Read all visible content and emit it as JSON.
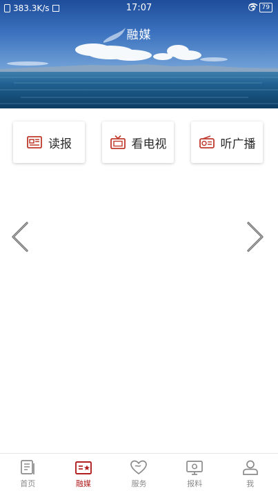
{
  "status_bar": {
    "network_speed": "383.3K/s",
    "time": "17:07",
    "battery": "79"
  },
  "page_title": "融媒",
  "features": [
    {
      "label": "读报",
      "icon": "newspaper-icon"
    },
    {
      "label": "看电视",
      "icon": "tv-icon"
    },
    {
      "label": "听广播",
      "icon": "radio-icon"
    }
  ],
  "carousel": {
    "prev_icon": "chevron-left-icon",
    "next_icon": "chevron-right-icon"
  },
  "tabbar": {
    "active": "融媒",
    "items": [
      {
        "label": "首页",
        "icon": "home-doc-icon"
      },
      {
        "label": "融媒",
        "icon": "media-icon"
      },
      {
        "label": "服务",
        "icon": "service-heart-icon"
      },
      {
        "label": "报料",
        "icon": "report-icon"
      },
      {
        "label": "我",
        "icon": "user-icon"
      }
    ]
  },
  "colors": {
    "accent": "#b11e1e",
    "icon_red": "#c0392b",
    "inactive": "#8a8a8a"
  }
}
